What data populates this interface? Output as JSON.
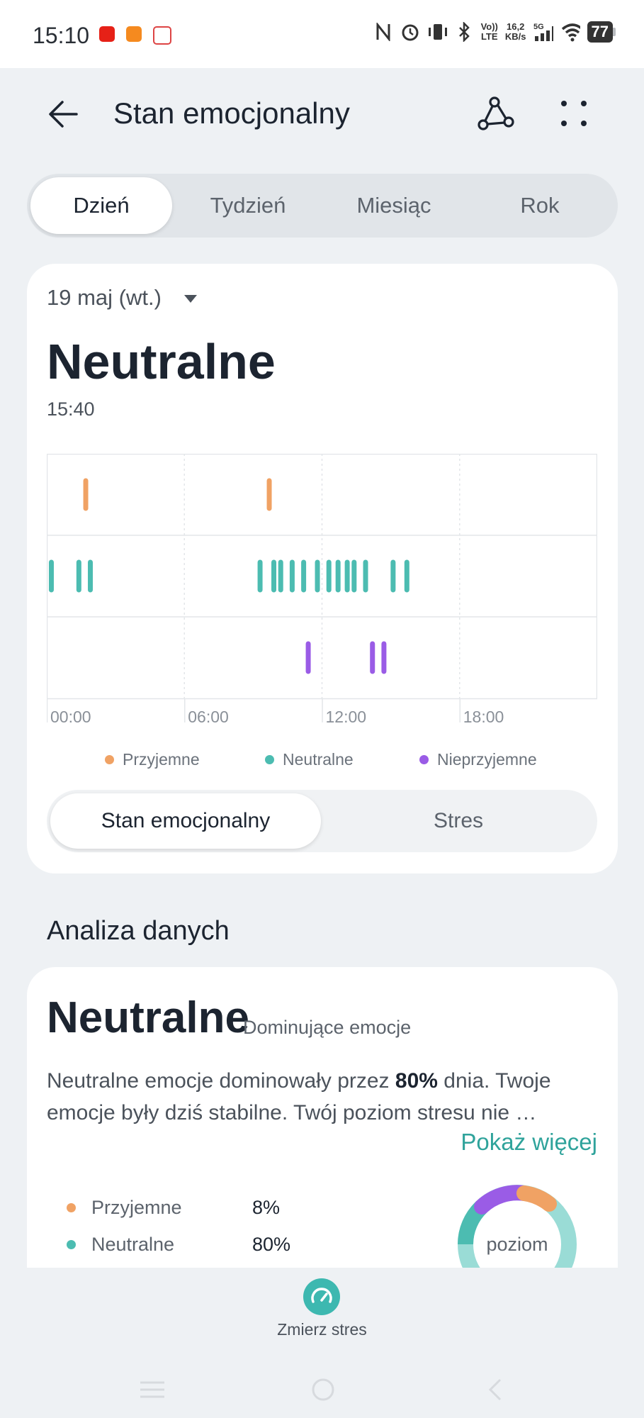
{
  "status_bar": {
    "time": "15:10",
    "net_speed_top": "16,2",
    "net_speed_bottom": "KB/s",
    "volte_top": "Vo))",
    "volte_bottom": "LTE",
    "network_type": "5G",
    "battery": "77",
    "icons": [
      "youtube-icon",
      "app-icon",
      "gmail-icon",
      "nfc-icon",
      "alarm-icon",
      "vibrate-icon",
      "bluetooth-icon",
      "signal-icon",
      "wifi-icon",
      "battery-icon"
    ]
  },
  "header": {
    "title": "Stan emocjonalny"
  },
  "period_tabs": [
    "Dzień",
    "Tydzień",
    "Miesiąc",
    "Rok"
  ],
  "selected_period": "Dzień",
  "day_card": {
    "date_label": "19 maj (wt.)",
    "state": "Neutralne",
    "time": "15:40"
  },
  "chart_data": {
    "type": "scatter",
    "title": "",
    "xlabel": "",
    "ylabel": "",
    "x_ticks": [
      "00:00",
      "06:00",
      "12:00",
      "18:00"
    ],
    "x_range_hours": [
      0,
      24
    ],
    "rows": [
      "Przyjemne",
      "Neutralne",
      "Nieprzyjemne"
    ],
    "grid": true,
    "series": [
      {
        "name": "Przyjemne",
        "color": "#f0a264",
        "hours": [
          1.7,
          9.7
        ]
      },
      {
        "name": "Neutralne",
        "color": "#4cbcb1",
        "hours": [
          0.2,
          1.4,
          1.9,
          9.3,
          9.9,
          10.2,
          10.7,
          11.2,
          11.8,
          12.3,
          12.7,
          13.1,
          13.4,
          13.9,
          15.1,
          15.7
        ]
      },
      {
        "name": "Nieprzyjemne",
        "color": "#9a5ce6",
        "hours": [
          11.4,
          14.2,
          14.7
        ]
      }
    ],
    "legend": [
      "Przyjemne",
      "Neutralne",
      "Nieprzyjemne"
    ],
    "legend_placement": "bottom"
  },
  "chart_toggle": [
    "Stan emocjonalny",
    "Stres"
  ],
  "chart_toggle_selected": "Stan emocjonalny",
  "analysis": {
    "section_title": "Analiza danych",
    "dominant_state": "Neutralne",
    "dominant_caption": "Dominujące emocje",
    "text_before": "Neutralne emocje dominowały przez ",
    "text_bold": "80%",
    "text_after": " dnia. Twoje emocje były dziś stabilne. Twój poziom stresu nie …",
    "show_more": "Pokaż więcej",
    "breakdown": [
      {
        "label": "Przyjemne",
        "pct": "8%",
        "color": "#f0a264"
      },
      {
        "label": "Neutralne",
        "pct": "80%",
        "color": "#4cbcb1"
      }
    ],
    "donut_label": "poziom"
  },
  "bottom": {
    "measure_label": "Zmierz stres"
  },
  "colors": {
    "accent_teal": "#2fa39b",
    "pleasant": "#f0a264",
    "neutral": "#4cbcb1",
    "unpleasant": "#9a5ce6"
  }
}
